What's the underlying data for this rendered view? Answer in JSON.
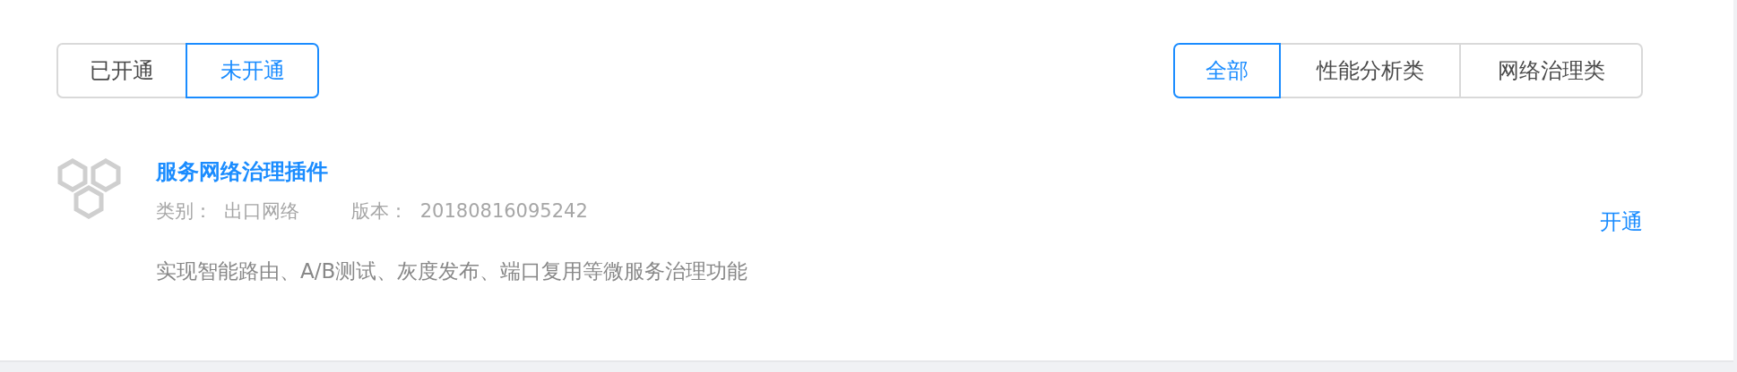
{
  "status_tabs": [
    {
      "label": "已开通",
      "selected": false
    },
    {
      "label": "未开通",
      "selected": true
    }
  ],
  "category_tabs": [
    {
      "label": "全部",
      "selected": true
    },
    {
      "label": "性能分析类",
      "selected": false
    },
    {
      "label": "网络治理类",
      "selected": false
    }
  ],
  "plugins": [
    {
      "name": "服务网络治理插件",
      "category_label": "类别：",
      "category": "出口网络",
      "version_label": "版本：",
      "version": "20180816095242",
      "description": "实现智能路由、A/B测试、灰度发布、端口复用等微服务治理功能",
      "action": "开通"
    }
  ]
}
